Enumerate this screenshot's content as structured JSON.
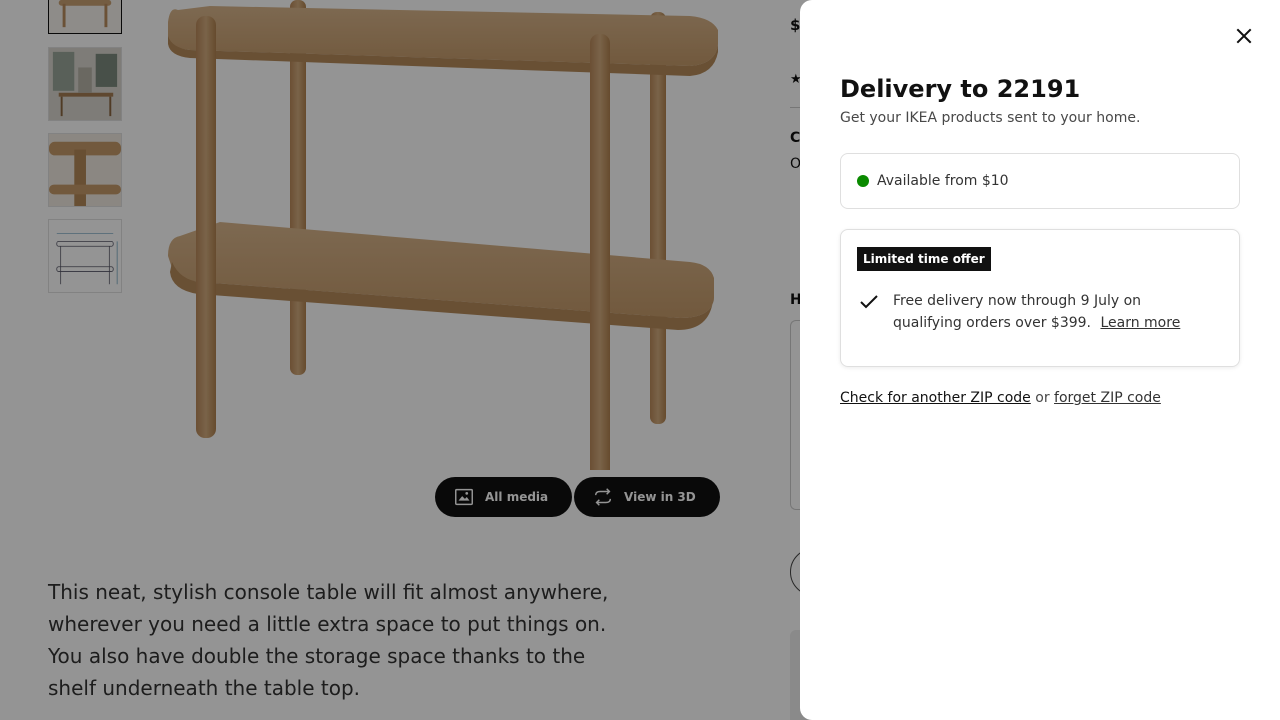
{
  "product": {
    "description": "This neat, stylish console table will fit almost anywhere, wherever you need a little extra space to put things on. You also have double the storage space thanks to the shelf underneath the table top.",
    "price_fragment": "$",
    "side_fragment_1": "C",
    "side_fragment_2": "O",
    "side_fragment_3": "H",
    "media_buttons": {
      "all_media": "All media",
      "view_3d": "View in 3D"
    },
    "thumbnails": [
      {
        "icon": "table-thumbnail-icon"
      },
      {
        "icon": "room-scene-thumbnail-icon"
      },
      {
        "icon": "detail-thumbnail-icon"
      },
      {
        "icon": "dimension-drawing-thumbnail-icon"
      }
    ]
  },
  "delivery_panel": {
    "title": "Delivery to 22191",
    "subtitle": "Get your IKEA products sent to your home.",
    "availability": "Available from $10",
    "availability_color": "#0a8a00",
    "offer": {
      "badge": "Limited time offer",
      "text": "Free delivery now through 9 July on qualifying orders over $399.",
      "link": "Learn more"
    },
    "links": {
      "check_zip": "Check for another ZIP code",
      "or": "or",
      "forget_zip": "forget ZIP code"
    }
  },
  "colors": {
    "overlay": "rgba(0,0,0,0.42)",
    "badge_bg": "#111111"
  }
}
